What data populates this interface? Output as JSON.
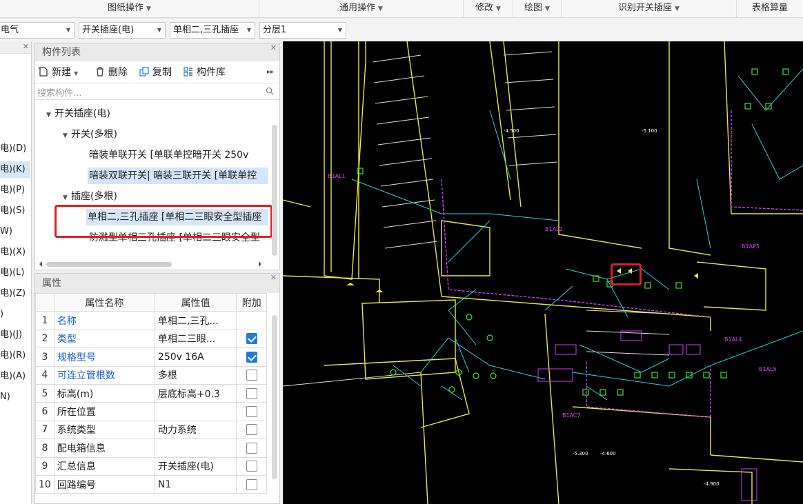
{
  "ribbon": {
    "groups": [
      "图纸操作",
      "通用操作",
      "修改",
      "绘图",
      "识别开关插座",
      "表格算量"
    ]
  },
  "selectors": {
    "discipline": "电气",
    "type": "开关插座(电)",
    "component": "单相二,三孔插座",
    "layer": "分层1"
  },
  "left_panel": {
    "items": [
      "电)(D)",
      "电)(K)",
      "电)(P)",
      "电)(S)",
      "W)",
      "电)(X)",
      "电)(L)",
      "电)(Z)",
      ")",
      "电)(J)",
      "电)(R)",
      "电)(A)",
      "N)"
    ],
    "selected_index": 1
  },
  "component_list": {
    "title": "构件列表",
    "toolbar": {
      "new": "新建",
      "delete": "删除",
      "copy": "复制",
      "library": "构件库"
    },
    "search_placeholder": "搜索构件...",
    "tree": [
      {
        "label": "开关插座(电)",
        "level": 0,
        "expand": true
      },
      {
        "label": "开关(多根)",
        "level": 1,
        "expand": true
      },
      {
        "label": "暗装单联开关 [单联单控暗开关 250v",
        "level": 2
      },
      {
        "label": "暗装双联开关| 暗装三联开关 [单联单控",
        "level": 2,
        "highlight": true
      },
      {
        "label": "插座(多根)",
        "level": 1,
        "expand": true
      },
      {
        "label": "单相二,三孔插座 [单相二三眼安全型插座",
        "level": 2,
        "highlight": true
      },
      {
        "label": "防溅型单相三孔插座 [单相二三眼安全型",
        "level": 2
      }
    ]
  },
  "properties": {
    "title": "属性",
    "headers": [
      "属性名称",
      "属性值",
      "附加"
    ],
    "rows": [
      {
        "num": "1",
        "name": "名称",
        "value": "单相二,三孔...",
        "blue": true,
        "check": null
      },
      {
        "num": "2",
        "name": "类型",
        "value": "单相二三眼...",
        "blue": true,
        "check": true
      },
      {
        "num": "3",
        "name": "规格型号",
        "value": "250v 16A",
        "blue": true,
        "check": true
      },
      {
        "num": "4",
        "name": "可连立管根数",
        "value": "多根",
        "blue": true,
        "check": false
      },
      {
        "num": "5",
        "name": "标高(m)",
        "value": "层底标高+0.3",
        "blue": false,
        "check": false
      },
      {
        "num": "6",
        "name": "所在位置",
        "value": "",
        "blue": false,
        "check": false
      },
      {
        "num": "7",
        "name": "系统类型",
        "value": "动力系统",
        "blue": false,
        "check": false
      },
      {
        "num": "8",
        "name": "配电箱信息",
        "value": "",
        "blue": false,
        "check": false
      },
      {
        "num": "9",
        "name": "汇总信息",
        "value": "开关插座(电)",
        "blue": false,
        "check": false
      },
      {
        "num": "10",
        "name": "回路编号",
        "value": "N1",
        "blue": false,
        "check": false
      }
    ]
  },
  "cad_labels": {
    "l1": "B1AL1",
    "l2": "B1AL2",
    "l3": "B1AP5",
    "l4": "B1AL5",
    "l5": "B1AL4",
    "l6": "B1AC7",
    "l7": "-4.500",
    "l8": "-5.100",
    "l9": "-4.600",
    "l10": "-5.300",
    "l11": "-4.900"
  },
  "colors": {
    "accent": "#1f7ae0",
    "highlight": "#d6e6fa",
    "red": "#e02020"
  }
}
